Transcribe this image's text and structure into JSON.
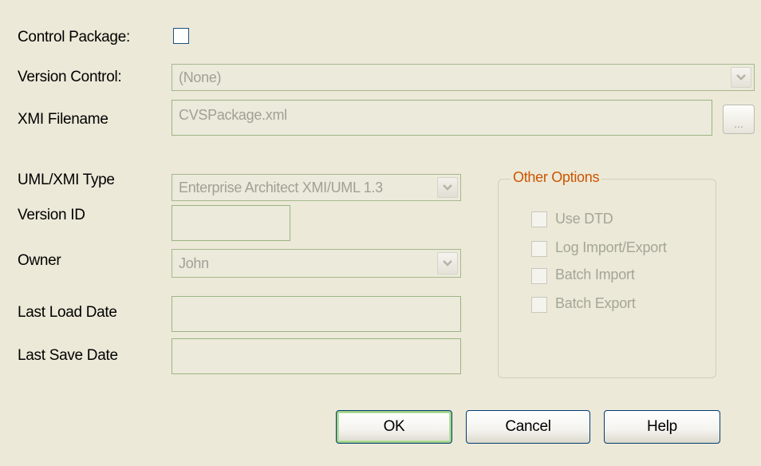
{
  "form": {
    "control_package_label": "Control Package:",
    "version_control_label": "Version Control:",
    "version_control_value": "(None)",
    "xmi_filename_label": "XMI Filename",
    "xmi_filename_value": "CVSPackage.xml",
    "ellipsis_label": "...",
    "uml_xmi_type_label": "UML/XMI Type",
    "uml_xmi_type_value": "Enterprise Architect XMI/UML 1.3",
    "version_id_label": "Version ID",
    "version_id_value": "",
    "owner_label": "Owner",
    "owner_value": "John",
    "last_load_date_label": "Last Load Date",
    "last_load_date_value": "",
    "last_save_date_label": "Last Save Date",
    "last_save_date_value": ""
  },
  "other_options": {
    "title": "Other Options",
    "use_dtd": "Use DTD",
    "log_import_export": "Log Import/Export",
    "batch_import": "Batch Import",
    "batch_export": "Batch Export"
  },
  "buttons": {
    "ok": "OK",
    "cancel": "Cancel",
    "help": "Help"
  },
  "colors": {
    "background": "#ece9d8",
    "group_title": "#cc5500",
    "field_border": "#a5b88c"
  }
}
